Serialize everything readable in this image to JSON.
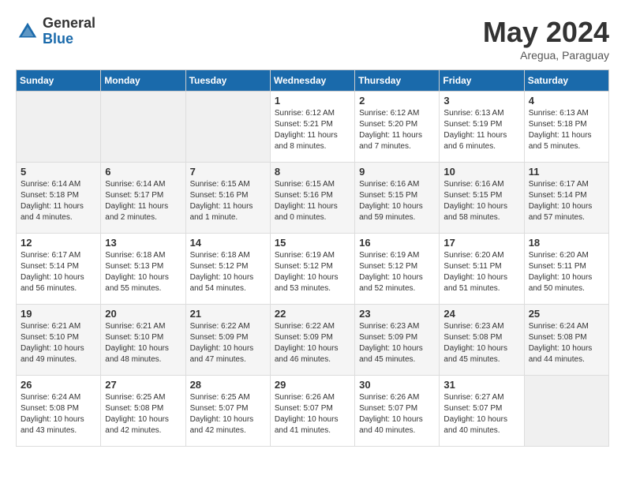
{
  "header": {
    "logo_general": "General",
    "logo_blue": "Blue",
    "month_title": "May 2024",
    "location": "Aregua, Paraguay"
  },
  "weekdays": [
    "Sunday",
    "Monday",
    "Tuesday",
    "Wednesday",
    "Thursday",
    "Friday",
    "Saturday"
  ],
  "weeks": [
    [
      {
        "day": "",
        "info": ""
      },
      {
        "day": "",
        "info": ""
      },
      {
        "day": "",
        "info": ""
      },
      {
        "day": "1",
        "info": "Sunrise: 6:12 AM\nSunset: 5:21 PM\nDaylight: 11 hours\nand 8 minutes."
      },
      {
        "day": "2",
        "info": "Sunrise: 6:12 AM\nSunset: 5:20 PM\nDaylight: 11 hours\nand 7 minutes."
      },
      {
        "day": "3",
        "info": "Sunrise: 6:13 AM\nSunset: 5:19 PM\nDaylight: 11 hours\nand 6 minutes."
      },
      {
        "day": "4",
        "info": "Sunrise: 6:13 AM\nSunset: 5:18 PM\nDaylight: 11 hours\nand 5 minutes."
      }
    ],
    [
      {
        "day": "5",
        "info": "Sunrise: 6:14 AM\nSunset: 5:18 PM\nDaylight: 11 hours\nand 4 minutes."
      },
      {
        "day": "6",
        "info": "Sunrise: 6:14 AM\nSunset: 5:17 PM\nDaylight: 11 hours\nand 2 minutes."
      },
      {
        "day": "7",
        "info": "Sunrise: 6:15 AM\nSunset: 5:16 PM\nDaylight: 11 hours\nand 1 minute."
      },
      {
        "day": "8",
        "info": "Sunrise: 6:15 AM\nSunset: 5:16 PM\nDaylight: 11 hours\nand 0 minutes."
      },
      {
        "day": "9",
        "info": "Sunrise: 6:16 AM\nSunset: 5:15 PM\nDaylight: 10 hours\nand 59 minutes."
      },
      {
        "day": "10",
        "info": "Sunrise: 6:16 AM\nSunset: 5:15 PM\nDaylight: 10 hours\nand 58 minutes."
      },
      {
        "day": "11",
        "info": "Sunrise: 6:17 AM\nSunset: 5:14 PM\nDaylight: 10 hours\nand 57 minutes."
      }
    ],
    [
      {
        "day": "12",
        "info": "Sunrise: 6:17 AM\nSunset: 5:14 PM\nDaylight: 10 hours\nand 56 minutes."
      },
      {
        "day": "13",
        "info": "Sunrise: 6:18 AM\nSunset: 5:13 PM\nDaylight: 10 hours\nand 55 minutes."
      },
      {
        "day": "14",
        "info": "Sunrise: 6:18 AM\nSunset: 5:12 PM\nDaylight: 10 hours\nand 54 minutes."
      },
      {
        "day": "15",
        "info": "Sunrise: 6:19 AM\nSunset: 5:12 PM\nDaylight: 10 hours\nand 53 minutes."
      },
      {
        "day": "16",
        "info": "Sunrise: 6:19 AM\nSunset: 5:12 PM\nDaylight: 10 hours\nand 52 minutes."
      },
      {
        "day": "17",
        "info": "Sunrise: 6:20 AM\nSunset: 5:11 PM\nDaylight: 10 hours\nand 51 minutes."
      },
      {
        "day": "18",
        "info": "Sunrise: 6:20 AM\nSunset: 5:11 PM\nDaylight: 10 hours\nand 50 minutes."
      }
    ],
    [
      {
        "day": "19",
        "info": "Sunrise: 6:21 AM\nSunset: 5:10 PM\nDaylight: 10 hours\nand 49 minutes."
      },
      {
        "day": "20",
        "info": "Sunrise: 6:21 AM\nSunset: 5:10 PM\nDaylight: 10 hours\nand 48 minutes."
      },
      {
        "day": "21",
        "info": "Sunrise: 6:22 AM\nSunset: 5:09 PM\nDaylight: 10 hours\nand 47 minutes."
      },
      {
        "day": "22",
        "info": "Sunrise: 6:22 AM\nSunset: 5:09 PM\nDaylight: 10 hours\nand 46 minutes."
      },
      {
        "day": "23",
        "info": "Sunrise: 6:23 AM\nSunset: 5:09 PM\nDaylight: 10 hours\nand 45 minutes."
      },
      {
        "day": "24",
        "info": "Sunrise: 6:23 AM\nSunset: 5:08 PM\nDaylight: 10 hours\nand 45 minutes."
      },
      {
        "day": "25",
        "info": "Sunrise: 6:24 AM\nSunset: 5:08 PM\nDaylight: 10 hours\nand 44 minutes."
      }
    ],
    [
      {
        "day": "26",
        "info": "Sunrise: 6:24 AM\nSunset: 5:08 PM\nDaylight: 10 hours\nand 43 minutes."
      },
      {
        "day": "27",
        "info": "Sunrise: 6:25 AM\nSunset: 5:08 PM\nDaylight: 10 hours\nand 42 minutes."
      },
      {
        "day": "28",
        "info": "Sunrise: 6:25 AM\nSunset: 5:07 PM\nDaylight: 10 hours\nand 42 minutes."
      },
      {
        "day": "29",
        "info": "Sunrise: 6:26 AM\nSunset: 5:07 PM\nDaylight: 10 hours\nand 41 minutes."
      },
      {
        "day": "30",
        "info": "Sunrise: 6:26 AM\nSunset: 5:07 PM\nDaylight: 10 hours\nand 40 minutes."
      },
      {
        "day": "31",
        "info": "Sunrise: 6:27 AM\nSunset: 5:07 PM\nDaylight: 10 hours\nand 40 minutes."
      },
      {
        "day": "",
        "info": ""
      }
    ]
  ]
}
